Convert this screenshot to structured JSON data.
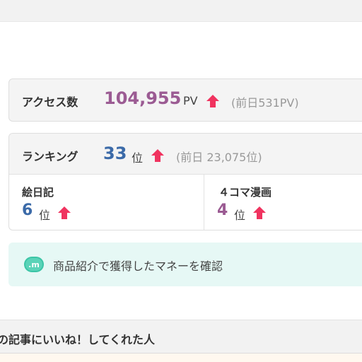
{
  "access": {
    "label": "アクセス数",
    "count": "104,955",
    "unit": "PV",
    "previous": "(前日531PV)",
    "trend_icon": "arrow-up-icon",
    "count_color": "#9b5b93"
  },
  "ranking": {
    "label": "ランキング",
    "rank": "33",
    "unit": "位",
    "previous": "(前日 23,075位)",
    "trend_icon": "arrow-up-icon",
    "rank_color": "#3b6aa8",
    "categories": [
      {
        "label": "絵日記",
        "rank": "6",
        "unit": "位",
        "color": "#3b6aa8"
      },
      {
        "label": "４コマ漫画",
        "rank": "4",
        "unit": "位",
        "color": "#9b5b93"
      }
    ]
  },
  "money": {
    "icon": "money-m-icon",
    "text": "商品紹介で獲得したマネーを確認",
    "bg_color": "#e6f8f5"
  },
  "likes": {
    "title": "の記事にいいね！してくれた人"
  },
  "colors": {
    "arrow": "#f0335f"
  }
}
